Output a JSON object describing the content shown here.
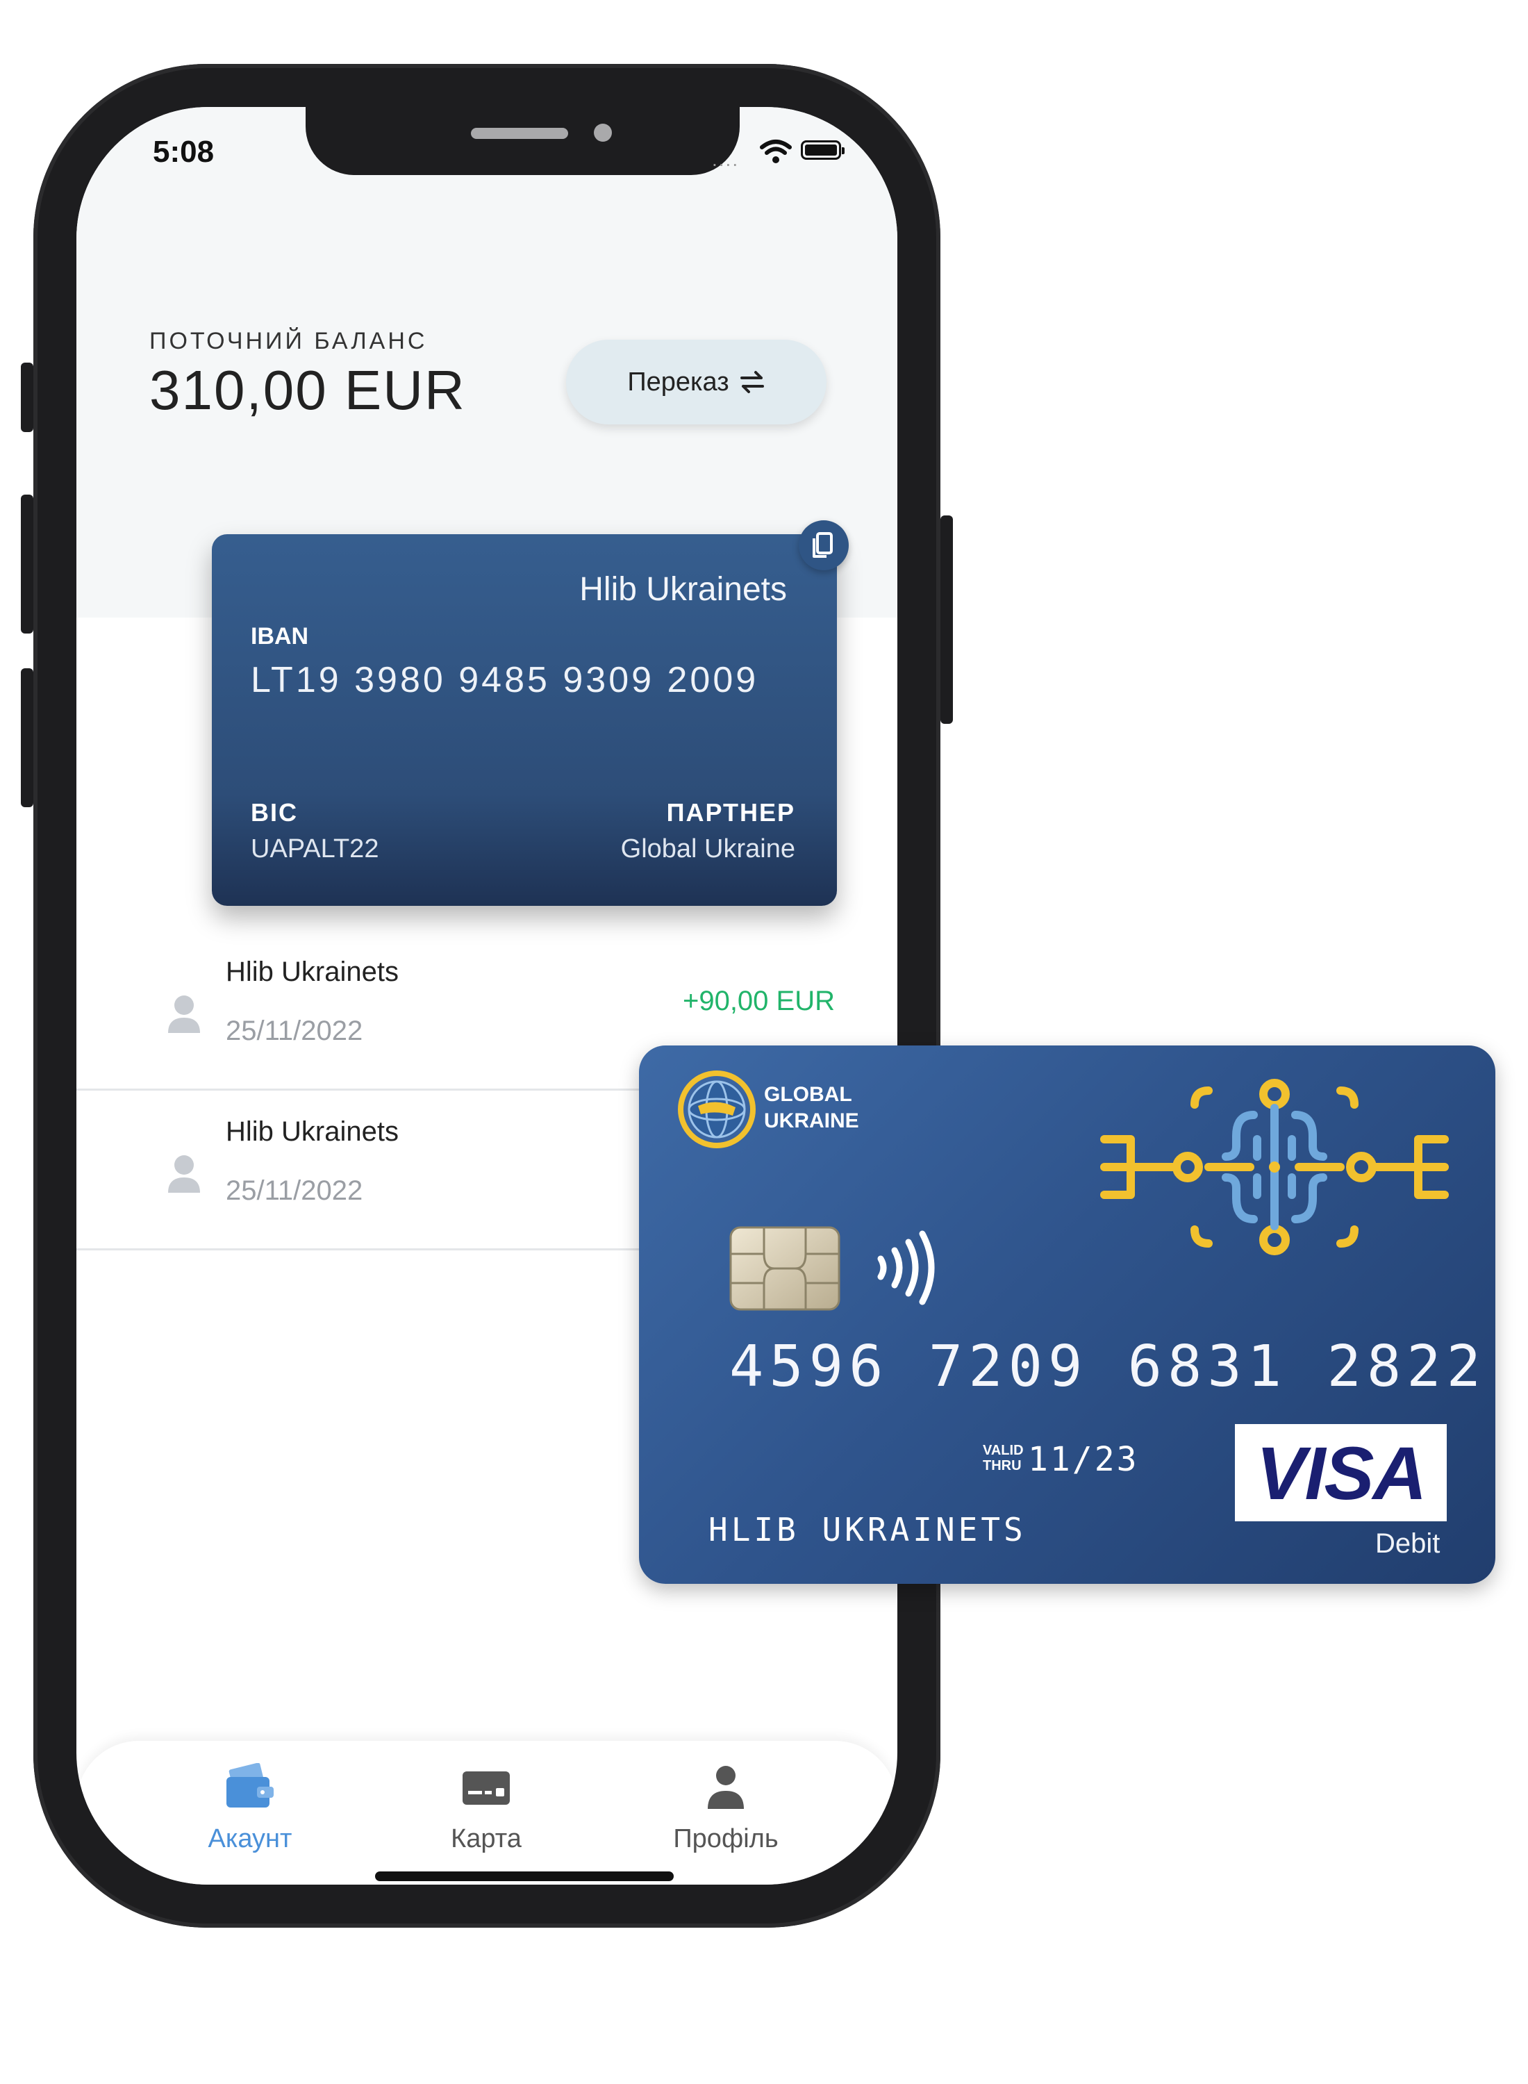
{
  "status_bar": {
    "time": "5:08",
    "signal_dots": "....",
    "icons": [
      "wifi-icon",
      "battery-icon"
    ]
  },
  "balance": {
    "label": "ПОТОЧНИЙ БАЛАНС",
    "value": "310,00 EUR"
  },
  "transfer_button": {
    "label": "Переказ",
    "icon": "transfer-arrows-icon"
  },
  "account_card": {
    "holder": "Hlib Ukrainets",
    "iban_label": "IBAN",
    "iban": "LT19 3980 9485 9309 2009",
    "bic_label": "BIC",
    "bic": "UAPALT22",
    "partner_label": "ПАРТНЕР",
    "partner": "Global Ukraine",
    "copy_icon": "copy-icon"
  },
  "transactions": [
    {
      "name": "Hlib Ukrainets",
      "date": "25/11/2022",
      "amount": "+90,00 EUR"
    },
    {
      "name": "Hlib Ukrainets",
      "date": "25/11/2022",
      "amount": ""
    }
  ],
  "bottom_nav": [
    {
      "label": "Акаунт",
      "icon": "wallet-icon",
      "active": true
    },
    {
      "label": "Карта",
      "icon": "card-icon",
      "active": false
    },
    {
      "label": "Профіль",
      "icon": "profile-icon",
      "active": false
    }
  ],
  "visa_card": {
    "brand_line1": "GLOBAL",
    "brand_line2": "UKRAINE",
    "number": "4596 7209 6831 2822",
    "valid_line1": "VALID",
    "valid_line2": "THRU",
    "expiry": "11/23",
    "holder": "HLIB UKRAINETS",
    "network": "VISA",
    "card_type": "Debit"
  },
  "colors": {
    "accent": "#4a90d9",
    "positive": "#21b46a",
    "card_blue": "#2f548c",
    "ornament_yellow": "#f2c12e",
    "ornament_blue": "#6fa8dc"
  }
}
